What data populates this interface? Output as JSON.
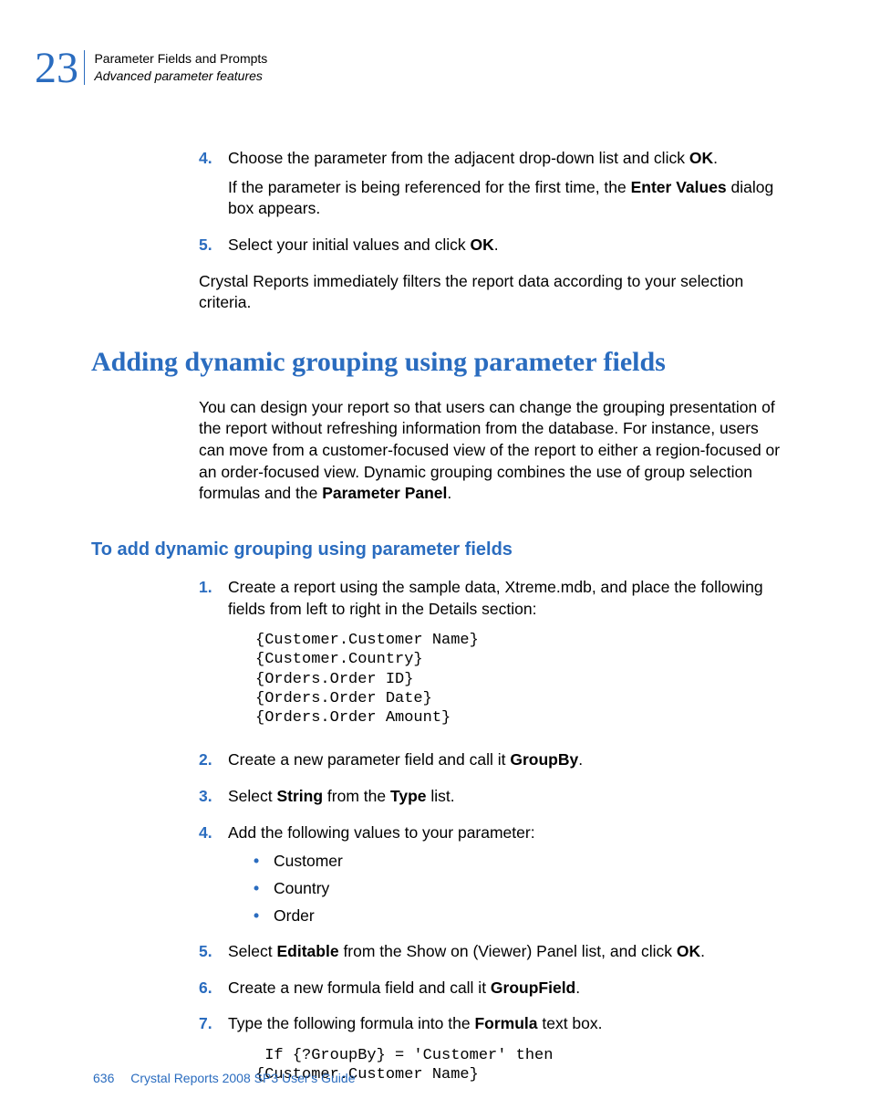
{
  "header": {
    "chapter_number": "23",
    "title_line1": "Parameter Fields and Prompts",
    "title_line2": "Advanced parameter features"
  },
  "steps_top": {
    "s4": {
      "num": "4.",
      "line1_a": "Choose the parameter from the adjacent drop-down list and click ",
      "line1_b": "OK",
      "line1_c": ".",
      "line2_a": "If the parameter is being referenced for the first time, the ",
      "line2_b": "Enter Values",
      "line2_c": " dialog box appears."
    },
    "s5": {
      "num": "5.",
      "a": "Select your initial values and click ",
      "b": "OK",
      "c": "."
    },
    "after": "Crystal Reports immediately filters the report data according to your selection criteria."
  },
  "heading1": "Adding dynamic grouping using parameter fields",
  "para1": {
    "a": "You can design your report so that users can change the grouping presentation of the report without refreshing information from the database. For instance, users can move from a customer-focused view of the report to either a region-focused or an order-focused view. Dynamic grouping combines the use of group selection formulas and the ",
    "b": "Parameter Panel",
    "c": "."
  },
  "heading2": "To add dynamic grouping using parameter fields",
  "steps": {
    "s1": {
      "num": "1.",
      "text": "Create a report using the sample data, Xtreme.mdb, and place the following fields from left to right in the Details section:",
      "code": "{Customer.Customer Name}\n{Customer.Country}\n{Orders.Order ID}\n{Orders.Order Date}\n{Orders.Order Amount}"
    },
    "s2": {
      "num": "2.",
      "a": "Create a new parameter field and call it ",
      "b": "GroupBy",
      "c": "."
    },
    "s3": {
      "num": "3.",
      "a": "Select ",
      "b": "String",
      "c": " from the ",
      "d": "Type",
      "e": " list."
    },
    "s4": {
      "num": "4.",
      "text": "Add the following values to your parameter:",
      "bullets": {
        "b1": "Customer",
        "b2": "Country",
        "b3": "Order"
      }
    },
    "s5": {
      "num": "5.",
      "a": "Select ",
      "b": "Editable",
      "c": " from the Show on (Viewer) Panel list, and click ",
      "d": "OK",
      "e": "."
    },
    "s6": {
      "num": "6.",
      "a": "Create a new formula field and call it ",
      "b": "GroupField",
      "c": "."
    },
    "s7": {
      "num": "7.",
      "a": "Type the following formula into the ",
      "b": "Formula",
      "c": " text box.",
      "code": " If {?GroupBy} = 'Customer' then\n{Customer.Customer Name}"
    }
  },
  "footer": {
    "page": "636",
    "book": "Crystal Reports 2008 SP3 User's Guide"
  }
}
